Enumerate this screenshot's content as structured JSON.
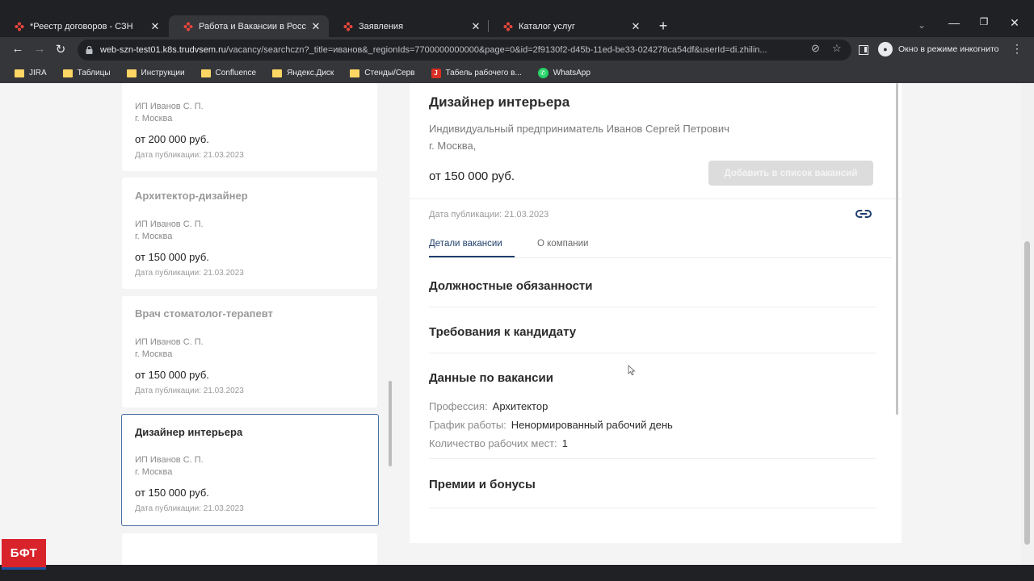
{
  "browser": {
    "tabs": [
      {
        "label": "*Реестр договоров - СЗН",
        "active": false
      },
      {
        "label": "Работа и Вакансии в России от",
        "active": true
      },
      {
        "label": "Заявления",
        "active": false
      },
      {
        "label": "Каталог услуг",
        "active": false
      }
    ],
    "url_host": "web-szn-test01.k8s.trudvsem.ru",
    "url_path": "/vacancy/searchczn?_title=иванов&_regionIds=7700000000000&page=0&id=2f9130f2-d45b-11ed-be33-024278ca54df&userId=di.zhilin...",
    "incognito_label": "Окно в режиме инкогнито",
    "bookmarks": [
      "JIRA",
      "Таблицы",
      "Инструкции",
      "Confluence",
      "Яндекс.Диск",
      "Стенды/Серв",
      "Табель рабочего в...",
      "WhatsApp"
    ],
    "icons": {
      "back": "arrow-left-icon",
      "forward": "arrow-right-icon",
      "reload": "reload-icon",
      "lock": "lock-icon",
      "star": "star-icon"
    }
  },
  "vacancy_list": [
    {
      "title": "",
      "employer": "ИП Иванов С. П.",
      "city": "г. Москва",
      "salary": "от 200 000 руб.",
      "date": "Дата публикации: 21.03.2023",
      "selected": false
    },
    {
      "title": "Архитектор-дизайнер",
      "employer": "ИП Иванов С. П.",
      "city": "г. Москва",
      "salary": "от 150 000 руб.",
      "date": "Дата публикации: 21.03.2023",
      "selected": false
    },
    {
      "title": "Врач стоматолог-терапевт",
      "employer": "ИП Иванов С. П.",
      "city": "г. Москва",
      "salary": "от 150 000 руб.",
      "date": "Дата публикации: 21.03.2023",
      "selected": false
    },
    {
      "title": "Дизайнер интерьера",
      "employer": "ИП Иванов С. П.",
      "city": "г. Москва",
      "salary": "от 150 000 руб.",
      "date": "Дата публикации: 21.03.2023",
      "selected": true
    }
  ],
  "detail": {
    "title": "Дизайнер интерьера",
    "employer": "Индивидуальный предприниматель Иванов Сергей Петрович",
    "city": "г. Москва,",
    "salary": "от 150 000 руб.",
    "add_button": "Добавить в список вакансий",
    "date": "Дата публикации: 21.03.2023",
    "tabs": {
      "details": "Детали вакансии",
      "company": "О компании"
    },
    "sections": {
      "duties": "Должностные обязанности",
      "requirements": "Требования к кандидату",
      "data": "Данные по вакансии",
      "bonuses": "Премии и бонусы"
    },
    "fields": [
      {
        "key": "Профессия:",
        "value": "Архитектор"
      },
      {
        "key": "График работы:",
        "value": "Ненормированный рабочий день"
      },
      {
        "key": "Количество рабочих мест:",
        "value": "1"
      }
    ]
  },
  "logo_text": "БФТ",
  "colors": {
    "accent": "#1f3f6b",
    "selected_border": "#4a6fa5",
    "logo_red": "#d8232a"
  }
}
